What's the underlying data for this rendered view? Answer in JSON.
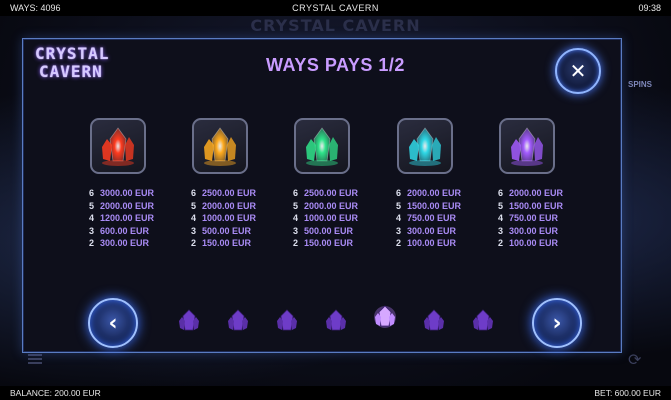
{
  "topbar": {
    "ways": "WAYS: 4096",
    "game_name": "CRYSTAL CAVERN",
    "clock": "09:38"
  },
  "background": {
    "title": "CRYSTAL CAVERN",
    "spins_fragment": "SPINS"
  },
  "panel": {
    "logo_line1": "CRYSTAL",
    "logo_line2": "CAVERN",
    "title": "WAYS PAYS 1/2",
    "close_glyph": "✕",
    "prev_glyph": "‹",
    "next_glyph": "›"
  },
  "symbols": [
    {
      "name": "red-crystal",
      "color": "#ff3b1f",
      "pays": [
        {
          "count": "6",
          "amount": "3000.00 EUR"
        },
        {
          "count": "5",
          "amount": "2000.00 EUR"
        },
        {
          "count": "4",
          "amount": "1200.00 EUR"
        },
        {
          "count": "3",
          "amount": "600.00 EUR"
        },
        {
          "count": "2",
          "amount": "300.00 EUR"
        }
      ]
    },
    {
      "name": "orange-crystal",
      "color": "#ffab1f",
      "pays": [
        {
          "count": "6",
          "amount": "2500.00 EUR"
        },
        {
          "count": "5",
          "amount": "2000.00 EUR"
        },
        {
          "count": "4",
          "amount": "1000.00 EUR"
        },
        {
          "count": "3",
          "amount": "500.00 EUR"
        },
        {
          "count": "2",
          "amount": "150.00 EUR"
        }
      ]
    },
    {
      "name": "green-crystal",
      "color": "#2fe38a",
      "pays": [
        {
          "count": "6",
          "amount": "2500.00 EUR"
        },
        {
          "count": "5",
          "amount": "2000.00 EUR"
        },
        {
          "count": "4",
          "amount": "1000.00 EUR"
        },
        {
          "count": "3",
          "amount": "500.00 EUR"
        },
        {
          "count": "2",
          "amount": "150.00 EUR"
        }
      ]
    },
    {
      "name": "cyan-crystal",
      "color": "#2fd8e6",
      "pays": [
        {
          "count": "6",
          "amount": "2000.00 EUR"
        },
        {
          "count": "5",
          "amount": "1500.00 EUR"
        },
        {
          "count": "4",
          "amount": "750.00 EUR"
        },
        {
          "count": "3",
          "amount": "300.00 EUR"
        },
        {
          "count": "2",
          "amount": "100.00 EUR"
        }
      ]
    },
    {
      "name": "purple-crystal",
      "color": "#a35cff",
      "pays": [
        {
          "count": "6",
          "amount": "2000.00 EUR"
        },
        {
          "count": "5",
          "amount": "1500.00 EUR"
        },
        {
          "count": "4",
          "amount": "750.00 EUR"
        },
        {
          "count": "3",
          "amount": "300.00 EUR"
        },
        {
          "count": "2",
          "amount": "100.00 EUR"
        }
      ]
    }
  ],
  "pagination": {
    "total_pages": 7,
    "active_index": 4
  },
  "bottombar": {
    "balance": "BALANCE: 200.00 EUR",
    "bet": "BET: 600.00 EUR"
  },
  "colors": {
    "accent_purple": "#c99cff",
    "pay_amount": "#a98bf5",
    "button_glow": "#3f73ff"
  }
}
